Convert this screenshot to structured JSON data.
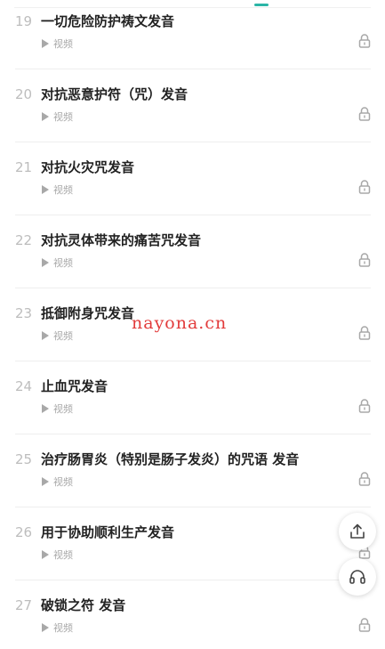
{
  "rows": [
    {
      "num": "19",
      "title": "一切危险防护祷文发音",
      "sub": "视频"
    },
    {
      "num": "20",
      "title": "对抗恶意护符（咒）发音",
      "sub": "视频"
    },
    {
      "num": "21",
      "title": "对抗火灾咒发音",
      "sub": "视频"
    },
    {
      "num": "22",
      "title": "对抗灵体带来的痛苦咒发音",
      "sub": "视频"
    },
    {
      "num": "23",
      "title": "抵御附身咒发音",
      "sub": "视频"
    },
    {
      "num": "24",
      "title": "止血咒发音",
      "sub": "视频"
    },
    {
      "num": "25",
      "title": "治疗肠胃炎（特别是肠子发炎）的咒语 发音",
      "sub": "视频"
    },
    {
      "num": "26",
      "title": "用于协助顺利生产发音",
      "sub": "视频"
    },
    {
      "num": "27",
      "title": "破锁之符 发音",
      "sub": "视频"
    }
  ],
  "watermark": "nayona.cn",
  "icons": {
    "play": "play-icon",
    "lock": "lock-icon",
    "share": "share-upload-icon",
    "support": "headset-icon"
  },
  "colors": {
    "accent": "#2bb5a6",
    "watermark": "#e23b3b"
  }
}
